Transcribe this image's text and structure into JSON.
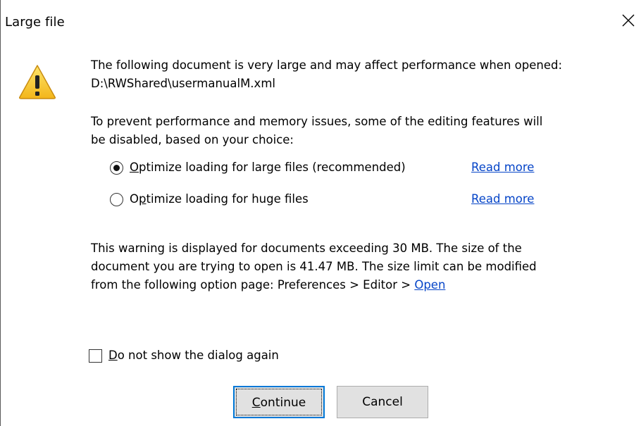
{
  "window": {
    "title": "Large file"
  },
  "icons": {
    "close": "close-icon",
    "warning": "warning-icon"
  },
  "message": {
    "line1": "The following document is very large and may affect performance when opened:",
    "path": "D:\\RWShared\\usermanualM.xml",
    "prevent_line1": "To prevent performance and memory issues, some of the editing features will",
    "prevent_line2": "be disabled, based on your choice:"
  },
  "options": [
    {
      "pre": "",
      "mnemonic": "O",
      "rest": "ptimize loading for large files (recommended)",
      "selected": true,
      "link": "Read more"
    },
    {
      "pre": "O",
      "mnemonic": "p",
      "rest": "timize loading for huge files",
      "selected": false,
      "link": "Read more"
    }
  ],
  "warning": {
    "line1": "This warning is displayed for documents exceeding 30 MB. The size of the",
    "line2": "document you are trying to open is 41.47 MB. The size limit can be modified",
    "line3": "from the following option page: Preferences > Editor > ",
    "link": "Open"
  },
  "checkbox": {
    "mnemonic": "D",
    "rest": "o not show the dialog again",
    "checked": false
  },
  "buttons": {
    "continue": {
      "mnemonic": "C",
      "rest": "ontinue"
    },
    "cancel": "Cancel"
  },
  "colors": {
    "link": "#0645c8",
    "focus_border": "#0078d7",
    "button_bg": "#e1e1e1"
  }
}
